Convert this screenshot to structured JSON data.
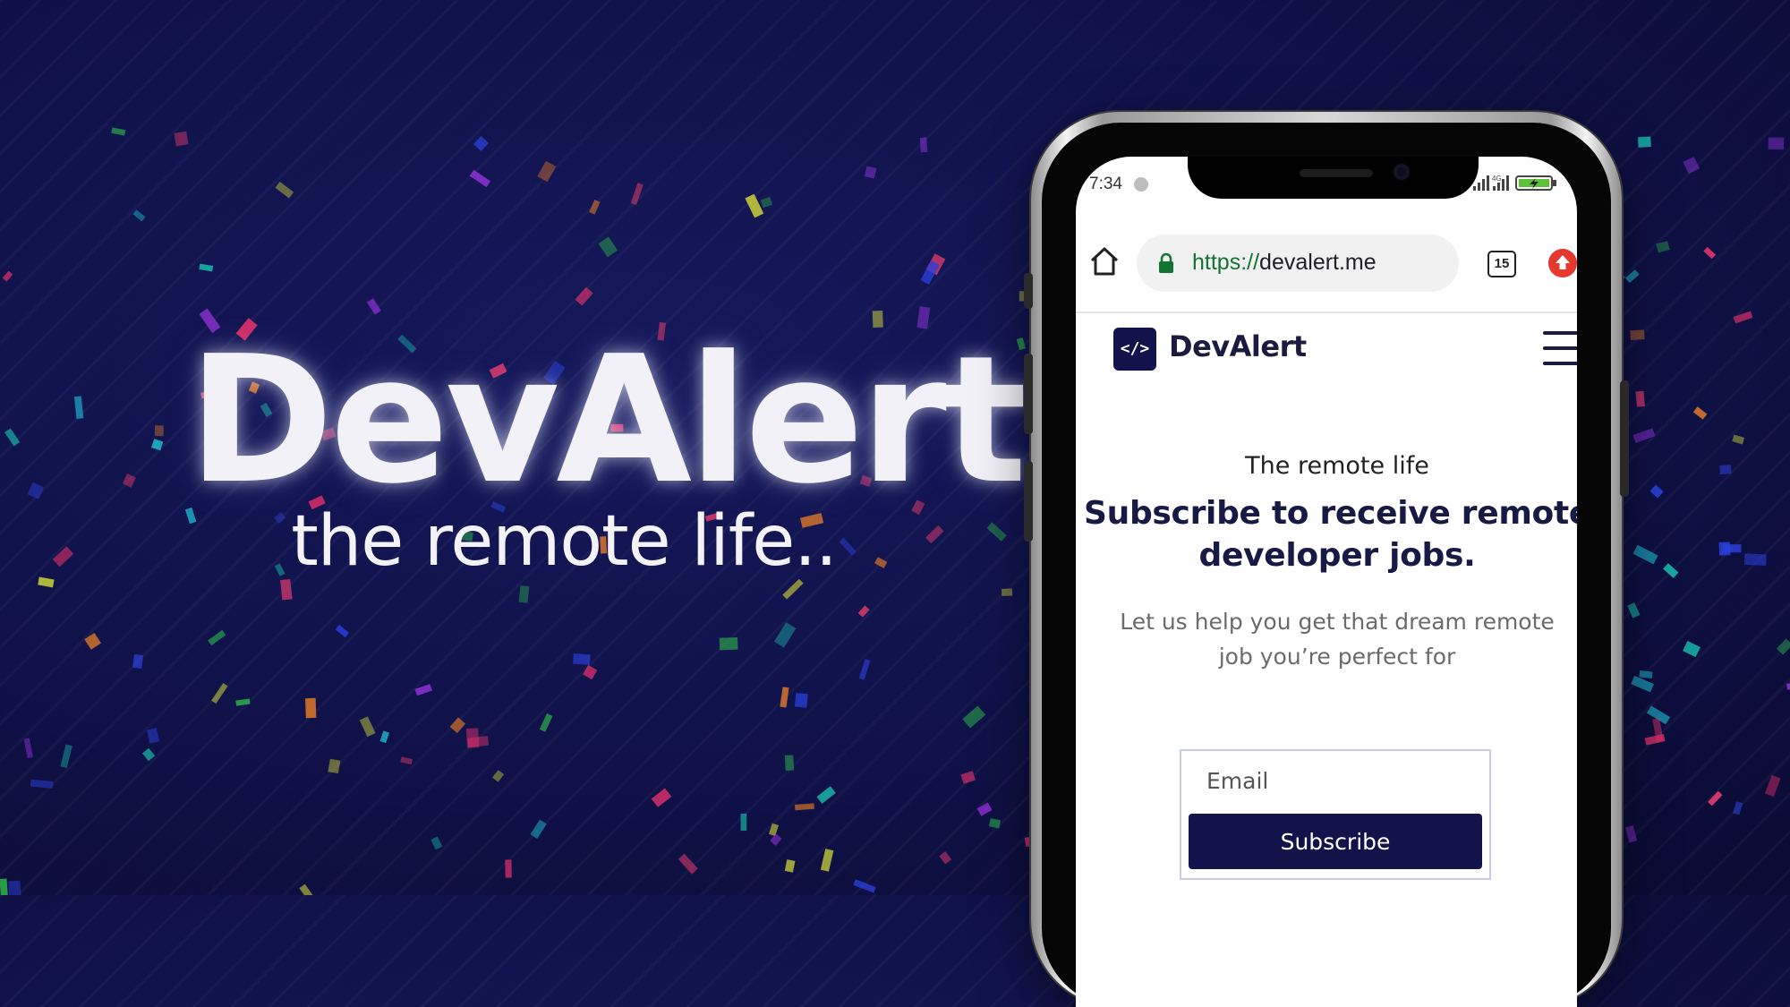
{
  "hero": {
    "title": "DevAlert",
    "subtitle": "the remote life.."
  },
  "phone": {
    "status_bar": {
      "time": "7:34",
      "network": "4G"
    },
    "browser": {
      "url_scheme": "https://",
      "url_host": "devalert.me",
      "tab_count": "15",
      "home_icon": "home-icon",
      "lock_icon": "lock-icon",
      "update_icon": "update-icon"
    },
    "site": {
      "logo_icon_text": "</>",
      "brand": "DevAlert",
      "eyebrow": "The remote life",
      "headline": "Subscribe to receive remote developer jobs.",
      "lead": "Let us help you get that dream remote job you’re perfect for",
      "email_placeholder": "Email",
      "subscribe_label": "Subscribe"
    }
  },
  "colors": {
    "background": "#0f1148",
    "brand_navy": "#12134a",
    "url_green": "#137333",
    "update_red": "#e5392f"
  }
}
